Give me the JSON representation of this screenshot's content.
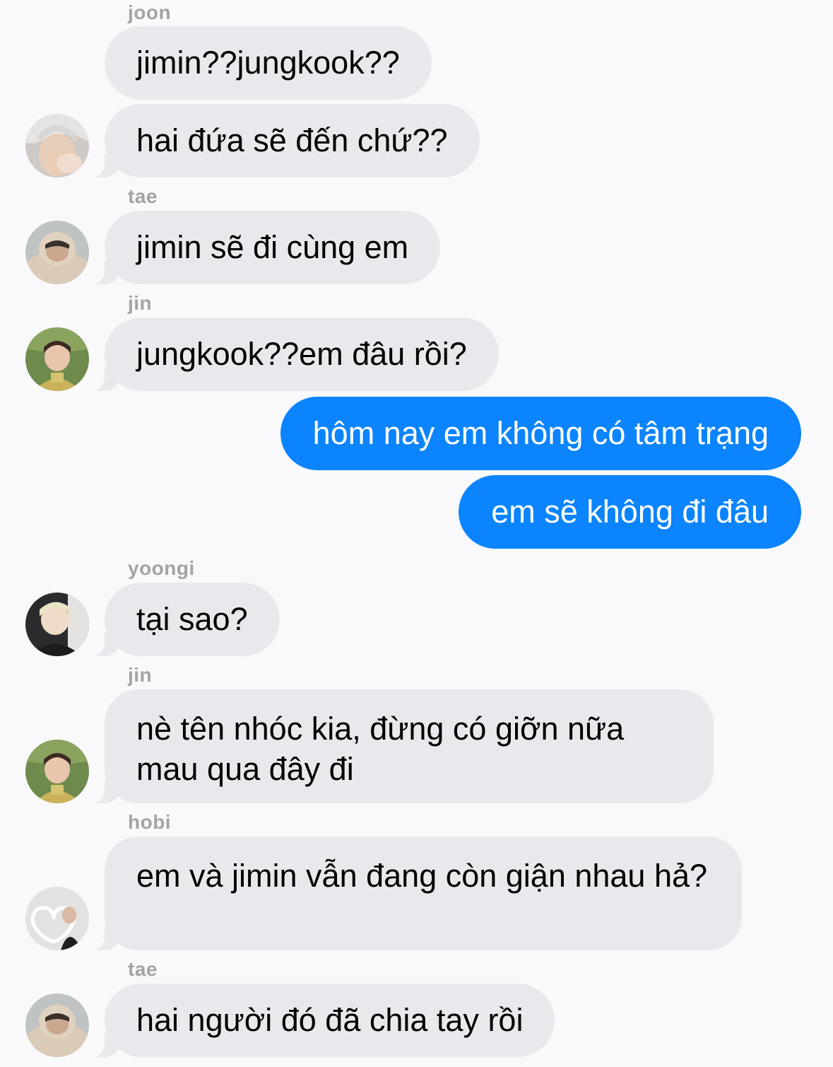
{
  "conversation": {
    "messages": [
      {
        "sender": "joon",
        "texts": [
          "jimin??jungkook??",
          "hai đứa sẽ đến chứ??"
        ]
      },
      {
        "sender": "tae",
        "texts": [
          "jimin sẽ đi cùng em"
        ]
      },
      {
        "sender": "jin",
        "texts": [
          "jungkook??em đâu rồi?"
        ]
      },
      {
        "sender": "me",
        "texts": [
          "hôm nay em không có tâm trạng",
          "em sẽ không đi đâu"
        ]
      },
      {
        "sender": "yoongi",
        "texts": [
          "tại sao?"
        ]
      },
      {
        "sender": "jin",
        "texts": [
          "nè tên nhóc kia, đừng có giỡn nữa mau qua đây đi"
        ]
      },
      {
        "sender": "hobi",
        "texts": [
          "em và jimin vẫn đang còn giận nhau hả?"
        ]
      },
      {
        "sender": "tae",
        "texts": [
          "hai người đó đã chia tay rồi"
        ]
      }
    ]
  },
  "colors": {
    "incoming_bubble": "#e9e8ed",
    "outgoing_bubble": "#0b84fe",
    "sender_label": "#a3a3a8",
    "background": "#f9f9fb"
  }
}
